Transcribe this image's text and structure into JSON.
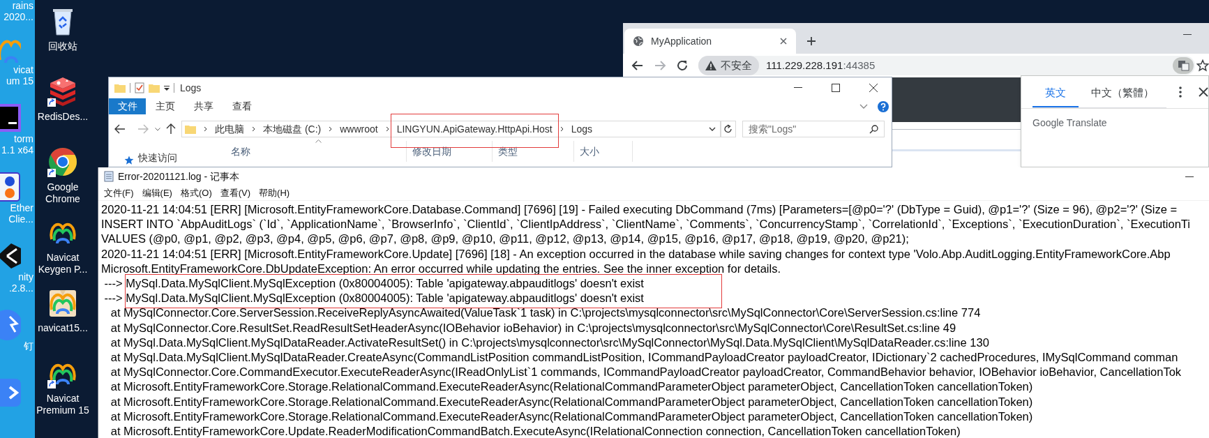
{
  "desktop": {
    "partial_icons": [
      {
        "kind": "none",
        "lines": [
          "rains",
          "2020..."
        ]
      },
      {
        "kind": "navicat",
        "lines": [
          "vicat",
          "um 15"
        ]
      },
      {
        "kind": "phpstorm",
        "lines": [
          "torm",
          "1.1 x64"
        ]
      },
      {
        "kind": "ether",
        "lines": [
          "Ether",
          "Clie..."
        ]
      },
      {
        "kind": "unity",
        "lines": [
          "nity",
          ".2.8..."
        ]
      },
      {
        "kind": "dingtalk",
        "lines": [
          "钉"
        ]
      },
      {
        "kind": "vpn"
      }
    ],
    "icons": [
      {
        "kind": "recycle",
        "lines": [
          "回收站"
        ],
        "shortcut": false
      },
      {
        "kind": "redis",
        "lines": [
          "RedisDes..."
        ],
        "shortcut": true
      },
      {
        "kind": "chrome",
        "lines": [
          "Google",
          "Chrome"
        ],
        "shortcut": true
      },
      {
        "kind": "navicat",
        "lines": [
          "Navicat",
          "Keygen P..."
        ],
        "shortcut": false
      },
      {
        "kind": "package",
        "lines": [
          "navicat15..."
        ],
        "shortcut": false
      },
      {
        "kind": "navicat",
        "lines": [
          "Navicat",
          "Premium 15"
        ],
        "shortcut": true
      }
    ]
  },
  "browser": {
    "tab": {
      "title": "MyApplication"
    },
    "security": "不安全",
    "url_host": "111.229.228.191",
    "url_port": ":44385",
    "translate_popup": {
      "tabs": [
        {
          "label": "英文",
          "selected": true
        },
        {
          "label": "中文（繁體）",
          "selected": false
        }
      ],
      "brand": "Google Translate"
    }
  },
  "explorer": {
    "title": "Logs",
    "ribbon_tabs": [
      {
        "label": "文件",
        "kind": "file"
      },
      {
        "label": "主页",
        "kind": "tab"
      },
      {
        "label": "共享",
        "kind": "tab"
      },
      {
        "label": "查看",
        "kind": "tab"
      }
    ],
    "breadcrumbs": [
      {
        "label": "此电脑",
        "boxed": false
      },
      {
        "label": "本地磁盘 (C:)",
        "boxed": false
      },
      {
        "label": "wwwroot",
        "boxed": false
      },
      {
        "label": "LINGYUN.ApiGateway.HttpApi.Host",
        "boxed": true
      },
      {
        "label": "Logs",
        "boxed": false
      }
    ],
    "search": {
      "placeholder": "搜索\"Logs\""
    },
    "nav_item": "快速访问",
    "columns": [
      "名称",
      "修改日期",
      "类型",
      "大小"
    ]
  },
  "notepad": {
    "title": "Error-20201121.log - 记事本",
    "menus": [
      "文件(F)",
      "编辑(E)",
      "格式(O)",
      "查看(V)",
      "帮助(H)"
    ],
    "lines": [
      {
        "text": "2020-11-21 14:04:51 [ERR] [Microsoft.EntityFrameworkCore.Database.Command] [7696] [19] - Failed executing DbCommand (7ms) [Parameters=[@p0='?' (DbType = Guid), @p1='?' (Size = 96), @p2='?' (Size =",
        "boxed": false
      },
      {
        "text": "INSERT INTO `AbpAuditLogs` (`Id`, `ApplicationName`, `BrowserInfo`, `ClientId`, `ClientIpAddress`, `ClientName`, `Comments`, `ConcurrencyStamp`, `CorrelationId`, `Exceptions`, `ExecutionDuration`, `ExecutionTi",
        "boxed": false
      },
      {
        "text": "VALUES (@p0, @p1, @p2, @p3, @p4, @p5, @p6, @p7, @p8, @p9, @p10, @p11, @p12, @p13, @p14, @p15, @p16, @p17, @p18, @p19, @p20, @p21);",
        "boxed": false
      },
      {
        "text": "2020-11-21 14:04:51 [ERR] [Microsoft.EntityFrameworkCore.Update] [7696] [18] - An exception occurred in the database while saving changes for context type 'Volo.Abp.AuditLogging.EntityFrameworkCore.Abp",
        "boxed": false
      },
      {
        "text": "Microsoft.EntityFrameworkCore.DbUpdateException: An error occurred while updating the entries. See the inner exception for details.",
        "boxed": false
      },
      {
        "text": " ---> MySql.Data.MySqlClient.MySqlException (0x80004005): Table 'apigateway.abpauditlogs' doesn't exist",
        "boxed": true
      },
      {
        "text": " ---> MySql.Data.MySqlClient.MySqlException (0x80004005): Table 'apigateway.abpauditlogs' doesn't exist",
        "boxed": true
      },
      {
        "text": "   at MySqlConnector.Core.ServerSession.ReceiveReplyAsyncAwaited(ValueTask`1 task) in C:\\projects\\mysqlconnector\\src\\MySqlConnector\\Core\\ServerSession.cs:line 774",
        "boxed": false
      },
      {
        "text": "   at MySqlConnector.Core.ResultSet.ReadResultSetHeaderAsync(IOBehavior ioBehavior) in C:\\projects\\mysqlconnector\\src\\MySqlConnector\\Core\\ResultSet.cs:line 49",
        "boxed": false
      },
      {
        "text": "   at MySql.Data.MySqlClient.MySqlDataReader.ActivateResultSet() in C:\\projects\\mysqlconnector\\src\\MySqlConnector\\MySql.Data.MySqlClient\\MySqlDataReader.cs:line 130",
        "boxed": false
      },
      {
        "text": "   at MySql.Data.MySqlClient.MySqlDataReader.CreateAsync(CommandListPosition commandListPosition, ICommandPayloadCreator payloadCreator, IDictionary`2 cachedProcedures, IMySqlCommand comman",
        "boxed": false
      },
      {
        "text": "   at MySqlConnector.Core.CommandExecutor.ExecuteReaderAsync(IReadOnlyList`1 commands, ICommandPayloadCreator payloadCreator, CommandBehavior behavior, IOBehavior ioBehavior, CancellationTok",
        "boxed": false
      },
      {
        "text": "   at Microsoft.EntityFrameworkCore.Storage.RelationalCommand.ExecuteReaderAsync(RelationalCommandParameterObject parameterObject, CancellationToken cancellationToken)",
        "boxed": false
      },
      {
        "text": "   at Microsoft.EntityFrameworkCore.Storage.RelationalCommand.ExecuteReaderAsync(RelationalCommandParameterObject parameterObject, CancellationToken cancellationToken)",
        "boxed": false
      },
      {
        "text": "   at Microsoft.EntityFrameworkCore.Storage.RelationalCommand.ExecuteReaderAsync(RelationalCommandParameterObject parameterObject, CancellationToken cancellationToken)",
        "boxed": false
      },
      {
        "text": "   at Microsoft.EntityFrameworkCore.Update.ReaderModificationCommandBatch.ExecuteAsync(IRelationalConnection connection, CancellationToken cancellationToken)",
        "boxed": false
      }
    ]
  }
}
